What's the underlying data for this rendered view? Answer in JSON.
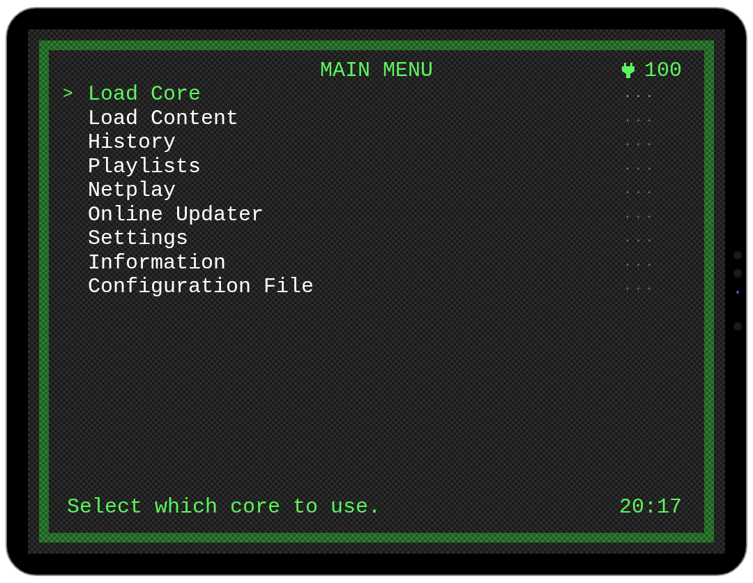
{
  "header": {
    "title": "MAIN MENU",
    "battery": "100",
    "charging": true
  },
  "menu": {
    "cursor": ">",
    "items": [
      {
        "label": "Load Core",
        "value": "...",
        "selected": true
      },
      {
        "label": "Load Content",
        "value": "...",
        "selected": false
      },
      {
        "label": "History",
        "value": "...",
        "selected": false
      },
      {
        "label": "Playlists",
        "value": "...",
        "selected": false
      },
      {
        "label": "Netplay",
        "value": "...",
        "selected": false
      },
      {
        "label": "Online Updater",
        "value": "...",
        "selected": false
      },
      {
        "label": "Settings",
        "value": "...",
        "selected": false
      },
      {
        "label": "Information",
        "value": "...",
        "selected": false
      },
      {
        "label": "Configuration File",
        "value": "...",
        "selected": false
      }
    ]
  },
  "footer": {
    "help": "Select which core to use.",
    "clock": "20:17"
  }
}
